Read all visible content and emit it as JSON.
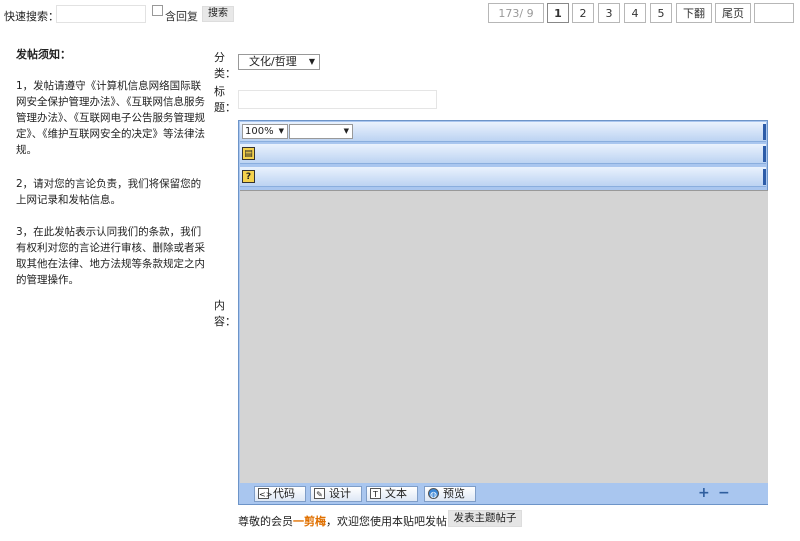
{
  "quick_search": {
    "label": "快速搜索：",
    "input_value": "",
    "checkbox_label": "含回复",
    "button_label": "搜索"
  },
  "pager": {
    "info": "173/ 9",
    "pages": [
      "1",
      "2",
      "3",
      "4",
      "5"
    ],
    "current": "1",
    "next": "下翻",
    "last": "尾页",
    "jump_value": ""
  },
  "notice": {
    "title": "发帖须知：",
    "p1": "1，发帖请遵守《计算机信息网络国际联网安全保护管理办法》、《互联网信息服务管理办法》、《互联网电子公告服务管理规定》、《维护互联网安全的决定》等法律法规。",
    "p2": "2，请对您的言论负责，我们将保留您的上网记录和发帖信息。",
    "p3": "3，在此发帖表示认同我们的条款，我们有权利对您的言论进行审核、删除或者采取其他在法律、地方法规等条款规定之内的管理操作。"
  },
  "form": {
    "category_label": "分类：",
    "category_value": "文化/哲理",
    "title_label": "标题：",
    "title_value": "",
    "content_label": "内容："
  },
  "editor": {
    "zoom_value": "100%",
    "font_select_value": "",
    "modes": [
      "代码",
      "设计",
      "文本",
      "预览"
    ],
    "plus": "+",
    "minus": "−"
  },
  "footer": {
    "prefix": "尊敬的会员",
    "member": "一剪梅",
    "suffix": "，欢迎您使用本贴吧发帖!",
    "post_button": "发表主题帖子"
  }
}
